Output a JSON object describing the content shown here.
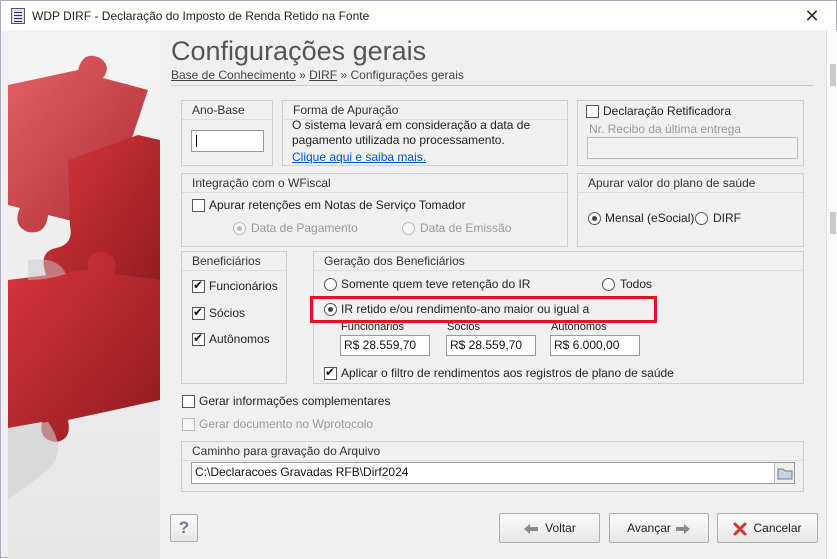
{
  "window": {
    "title": "WDP DIRF - Declaração do Imposto de Renda Retido na Fonte",
    "close_glyph": "✕"
  },
  "header": {
    "title": "Configurações gerais",
    "breadcrumb": [
      {
        "label": "Base de Conhecimento"
      },
      {
        "label": "DIRF"
      },
      {
        "label": "Configurações gerais"
      }
    ],
    "separator": "»"
  },
  "ano_base": {
    "title": "Ano-Base",
    "value": ""
  },
  "forma_apuracao": {
    "title": "Forma de Apuração",
    "text_line1": "O sistema levará em consideração a data de",
    "text_line2": "pagamento utilizada no processamento.",
    "link": "Clique aqui e saiba mais."
  },
  "retificadora": {
    "label": "Declaração Retificadora",
    "checked": false,
    "recibo_placeholder": "Nr. Recibo da última entrega",
    "recibo_value": ""
  },
  "wfiscal": {
    "title": "Integração com o WFiscal",
    "checkbox_label": "Apurar retenções em Notas de Serviço Tomador",
    "checked": false,
    "radio_pagamento": "Data de Pagamento",
    "radio_emissao": "Data de Emissão",
    "selected": "Data de Pagamento"
  },
  "plano_saude": {
    "title": "Apurar valor do plano de saúde",
    "options": [
      "Mensal (eSocial)",
      "DIRF"
    ],
    "selected": "Mensal (eSocial)"
  },
  "beneficiarios": {
    "title": "Beneficiários",
    "items": [
      {
        "label": "Funcionários",
        "checked": true
      },
      {
        "label": "Sócios",
        "checked": true
      },
      {
        "label": "Autônomos",
        "checked": true
      }
    ]
  },
  "geracao": {
    "title": "Geração dos Beneficiários",
    "option_somente": "Somente quem teve retenção do IR",
    "option_todos": "Todos",
    "option_ir": "IR retido e/ou rendimento-ano maior ou igual a",
    "selected": "IR retido e/ou rendimento-ano maior ou igual a",
    "fields": [
      {
        "label": "Funcionários",
        "value": "R$ 28.559,70"
      },
      {
        "label": "Sócios",
        "value": "R$ 28.559,70"
      },
      {
        "label": "Autônomos",
        "value": "R$ 6.000,00"
      }
    ],
    "filtro_label": "Aplicar o filtro de rendimentos aos registros de plano de saúde",
    "filtro_checked": true
  },
  "extras": {
    "complementares_label": "Gerar informações complementares",
    "complementares_checked": false,
    "wprotocolo_label": "Gerar documento no Wprotocolo",
    "wprotocolo_checked": false
  },
  "caminho": {
    "title": "Caminho para gravação do Arquivo",
    "value": "C:\\Declaracoes Gravadas RFB\\Dirf2024"
  },
  "buttons": {
    "help": "?",
    "voltar": "Voltar",
    "avancar": "Avançar",
    "cancelar": "Cancelar"
  },
  "colors": {
    "accent": "#0055cc",
    "highlight": "#e0161f",
    "puzzle_red": "#b3262d"
  },
  "icons": {
    "app": "document-icon",
    "close": "close-icon",
    "folder": "folder-icon",
    "back": "arrow-left-icon",
    "next": "arrow-right-icon",
    "cancel": "x-cancel-icon",
    "help": "question-icon"
  }
}
